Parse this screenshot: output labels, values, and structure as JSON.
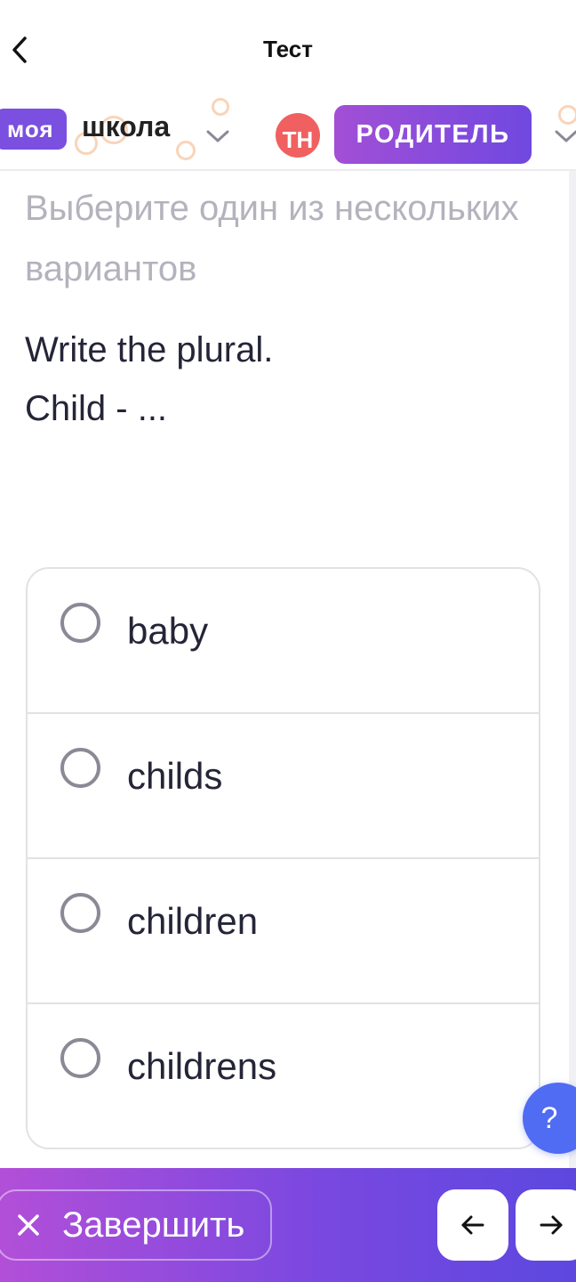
{
  "topbar": {
    "title": "Тест",
    "back_icon": "chevron-left-icon"
  },
  "header": {
    "logo_badge": "моя",
    "logo_text": "школа",
    "avatar_initials": "ТН",
    "role": "РОДИТЕЛЬ",
    "accent_color": "#7b4fe0",
    "avatar_color": "#f06060"
  },
  "quiz": {
    "hint": "Выберите один из нескольких вариантов",
    "question_line1": "Write the plural.",
    "question_line2": "Child - ...",
    "options": [
      {
        "label": "baby",
        "selected": false
      },
      {
        "label": "childs",
        "selected": false
      },
      {
        "label": "children",
        "selected": false
      },
      {
        "label": "childrens",
        "selected": false
      }
    ]
  },
  "help": {
    "label": "?"
  },
  "bottombar": {
    "finish_label": "Завершить",
    "finish_icon": "close-icon",
    "prev_icon": "arrow-left-icon",
    "next_icon": "arrow-right-icon"
  }
}
